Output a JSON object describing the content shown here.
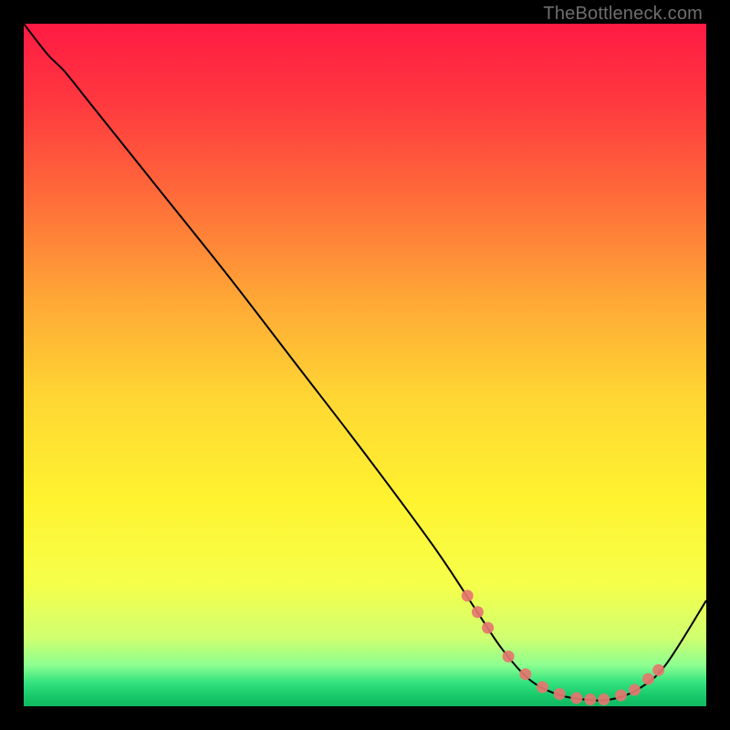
{
  "attribution": "TheBottleneck.com",
  "colors": {
    "black": "#000000",
    "curve": "#000000",
    "dot": "#e5766f",
    "attribution": "#6e6e6e"
  },
  "chart_data": {
    "type": "line",
    "title": "",
    "xlabel": "",
    "ylabel": "",
    "xlim": [
      0,
      100
    ],
    "ylim": [
      0,
      100
    ],
    "background_gradient": {
      "stops": [
        {
          "pos": 0.0,
          "color": "#ff1a44"
        },
        {
          "pos": 0.12,
          "color": "#ff3a3f"
        },
        {
          "pos": 0.25,
          "color": "#ff6a3a"
        },
        {
          "pos": 0.4,
          "color": "#ffa636"
        },
        {
          "pos": 0.55,
          "color": "#ffd733"
        },
        {
          "pos": 0.7,
          "color": "#fff330"
        },
        {
          "pos": 0.82,
          "color": "#f6ff4a"
        },
        {
          "pos": 0.9,
          "color": "#d0ff70"
        },
        {
          "pos": 0.94,
          "color": "#8cff90"
        },
        {
          "pos": 0.965,
          "color": "#34e27f"
        },
        {
          "pos": 0.985,
          "color": "#17c96b"
        },
        {
          "pos": 1.0,
          "color": "#0fb85f"
        }
      ]
    },
    "series": [
      {
        "name": "bottleneck-curve",
        "x": [
          0.0,
          3.5,
          6.0,
          10.0,
          20.0,
          30.0,
          40.0,
          50.0,
          60.0,
          66.0,
          70.0,
          74.0,
          78.0,
          82.0,
          86.0,
          90.0,
          94.0,
          100.0
        ],
        "y": [
          100.0,
          95.5,
          93.0,
          88.0,
          75.5,
          63.0,
          50.0,
          37.0,
          23.5,
          14.5,
          8.5,
          4.0,
          1.8,
          1.0,
          1.0,
          2.5,
          6.0,
          15.5
        ]
      }
    ],
    "dots": {
      "name": "highlight-dots",
      "x": [
        65.0,
        66.5,
        68.0,
        71.0,
        73.5,
        76.0,
        78.5,
        81.0,
        83.0,
        85.0,
        87.5,
        89.5,
        91.5,
        93.0
      ],
      "y": [
        16.2,
        13.8,
        11.5,
        7.3,
        4.7,
        2.8,
        1.8,
        1.2,
        1.0,
        1.0,
        1.6,
        2.4,
        4.0,
        5.3
      ]
    }
  }
}
